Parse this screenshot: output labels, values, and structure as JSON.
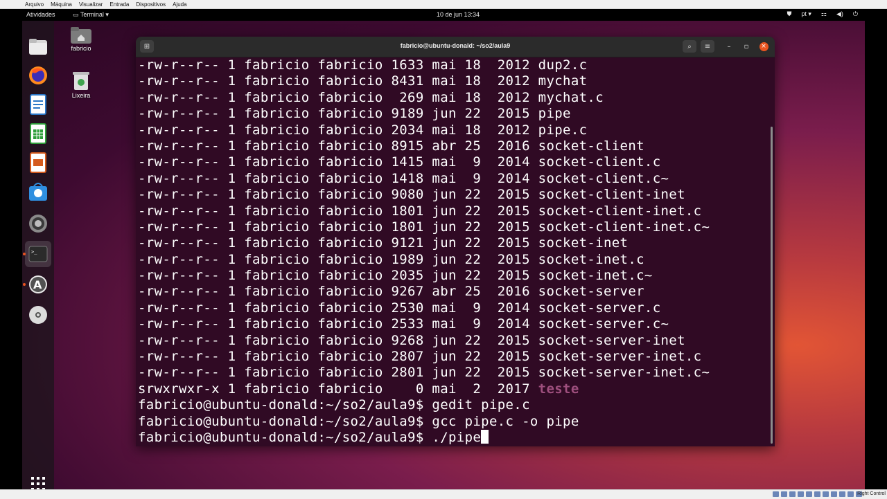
{
  "host_menu": [
    "Arquivo",
    "Máquina",
    "Visualizar",
    "Entrada",
    "Dispositivos",
    "Ajuda"
  ],
  "topbar": {
    "activities": "Atividades",
    "app_menu": "Terminal ▾",
    "clock": "10 de jun  13:34",
    "lang": "pt ▾"
  },
  "desktop": {
    "home_label": "fabricio",
    "trash_label": "Lixeira"
  },
  "dock": {
    "items": [
      "files-icon",
      "firefox-icon",
      "writer-icon",
      "calc-icon",
      "impress-icon",
      "software-icon",
      "settings-icon",
      "terminal-icon",
      "software-updater-icon",
      "dvd-icon"
    ],
    "apps_grid": "show-applications-icon"
  },
  "terminal": {
    "title": "fabricio@ubuntu-donald: ~/so2/aula9",
    "lines": [
      {
        "perm": "-rw-r--r--",
        "links": "1",
        "owner": "fabricio",
        "group": "fabricio",
        "size": "1633",
        "mon": "mai",
        "day": "18",
        "year": "2012",
        "name": "dup2.c"
      },
      {
        "perm": "-rw-r--r--",
        "links": "1",
        "owner": "fabricio",
        "group": "fabricio",
        "size": "8431",
        "mon": "mai",
        "day": "18",
        "year": "2012",
        "name": "mychat"
      },
      {
        "perm": "-rw-r--r--",
        "links": "1",
        "owner": "fabricio",
        "group": "fabricio",
        "size": "269",
        "mon": "mai",
        "day": "18",
        "year": "2012",
        "name": "mychat.c"
      },
      {
        "perm": "-rw-r--r--",
        "links": "1",
        "owner": "fabricio",
        "group": "fabricio",
        "size": "9189",
        "mon": "jun",
        "day": "22",
        "year": "2015",
        "name": "pipe"
      },
      {
        "perm": "-rw-r--r--",
        "links": "1",
        "owner": "fabricio",
        "group": "fabricio",
        "size": "2034",
        "mon": "mai",
        "day": "18",
        "year": "2012",
        "name": "pipe.c"
      },
      {
        "perm": "-rw-r--r--",
        "links": "1",
        "owner": "fabricio",
        "group": "fabricio",
        "size": "8915",
        "mon": "abr",
        "day": "25",
        "year": "2016",
        "name": "socket-client"
      },
      {
        "perm": "-rw-r--r--",
        "links": "1",
        "owner": "fabricio",
        "group": "fabricio",
        "size": "1415",
        "mon": "mai",
        "day": "9",
        "year": "2014",
        "name": "socket-client.c"
      },
      {
        "perm": "-rw-r--r--",
        "links": "1",
        "owner": "fabricio",
        "group": "fabricio",
        "size": "1418",
        "mon": "mai",
        "day": "9",
        "year": "2014",
        "name": "socket-client.c~"
      },
      {
        "perm": "-rw-r--r--",
        "links": "1",
        "owner": "fabricio",
        "group": "fabricio",
        "size": "9080",
        "mon": "jun",
        "day": "22",
        "year": "2015",
        "name": "socket-client-inet"
      },
      {
        "perm": "-rw-r--r--",
        "links": "1",
        "owner": "fabricio",
        "group": "fabricio",
        "size": "1801",
        "mon": "jun",
        "day": "22",
        "year": "2015",
        "name": "socket-client-inet.c"
      },
      {
        "perm": "-rw-r--r--",
        "links": "1",
        "owner": "fabricio",
        "group": "fabricio",
        "size": "1801",
        "mon": "jun",
        "day": "22",
        "year": "2015",
        "name": "socket-client-inet.c~"
      },
      {
        "perm": "-rw-r--r--",
        "links": "1",
        "owner": "fabricio",
        "group": "fabricio",
        "size": "9121",
        "mon": "jun",
        "day": "22",
        "year": "2015",
        "name": "socket-inet"
      },
      {
        "perm": "-rw-r--r--",
        "links": "1",
        "owner": "fabricio",
        "group": "fabricio",
        "size": "1989",
        "mon": "jun",
        "day": "22",
        "year": "2015",
        "name": "socket-inet.c"
      },
      {
        "perm": "-rw-r--r--",
        "links": "1",
        "owner": "fabricio",
        "group": "fabricio",
        "size": "2035",
        "mon": "jun",
        "day": "22",
        "year": "2015",
        "name": "socket-inet.c~"
      },
      {
        "perm": "-rw-r--r--",
        "links": "1",
        "owner": "fabricio",
        "group": "fabricio",
        "size": "9267",
        "mon": "abr",
        "day": "25",
        "year": "2016",
        "name": "socket-server"
      },
      {
        "perm": "-rw-r--r--",
        "links": "1",
        "owner": "fabricio",
        "group": "fabricio",
        "size": "2530",
        "mon": "mai",
        "day": "9",
        "year": "2014",
        "name": "socket-server.c"
      },
      {
        "perm": "-rw-r--r--",
        "links": "1",
        "owner": "fabricio",
        "group": "fabricio",
        "size": "2533",
        "mon": "mai",
        "day": "9",
        "year": "2014",
        "name": "socket-server.c~"
      },
      {
        "perm": "-rw-r--r--",
        "links": "1",
        "owner": "fabricio",
        "group": "fabricio",
        "size": "9268",
        "mon": "jun",
        "day": "22",
        "year": "2015",
        "name": "socket-server-inet"
      },
      {
        "perm": "-rw-r--r--",
        "links": "1",
        "owner": "fabricio",
        "group": "fabricio",
        "size": "2807",
        "mon": "jun",
        "day": "22",
        "year": "2015",
        "name": "socket-server-inet.c"
      },
      {
        "perm": "-rw-r--r--",
        "links": "1",
        "owner": "fabricio",
        "group": "fabricio",
        "size": "2801",
        "mon": "jun",
        "day": "22",
        "year": "2015",
        "name": "socket-server-inet.c~"
      },
      {
        "perm": "srwxrwxr-x",
        "links": "1",
        "owner": "fabricio",
        "group": "fabricio",
        "size": "0",
        "mon": "mai",
        "day": "2",
        "year": "2017",
        "name": "teste",
        "is_socket": true
      }
    ],
    "prompt": "fabricio@ubuntu-donald:~/so2/aula9$",
    "commands": [
      "gedit pipe.c",
      "gcc pipe.c -o pipe",
      "./pipe"
    ]
  },
  "status_bar": {
    "host_key": "Right Control"
  },
  "colors": {
    "terminal_bg": "#300a24",
    "socket_file": "#9e4f7e",
    "accent": "#e95420"
  }
}
